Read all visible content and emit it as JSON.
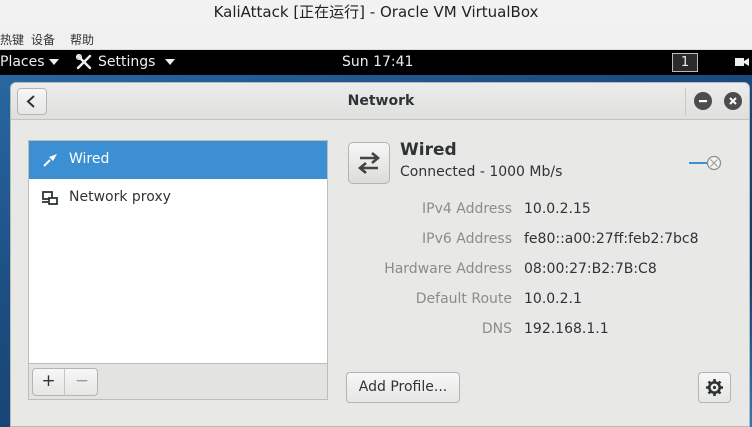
{
  "host": {
    "window_title": "KaliAttack [正在运行] - Oracle VM VirtualBox",
    "menu": [
      "热键",
      "设备",
      "帮助"
    ]
  },
  "topbar": {
    "places_label": "Places",
    "settings_label": "Settings",
    "clock": "Sun 17:41",
    "workspace": "1"
  },
  "window": {
    "title": "Network"
  },
  "sidebar": {
    "items": [
      {
        "label": "Wired",
        "icon": "ethernet-icon",
        "selected": true
      },
      {
        "label": "Network proxy",
        "icon": "proxy-icon",
        "selected": false
      }
    ],
    "add_label": "+",
    "remove_label": "−"
  },
  "device": {
    "name": "Wired",
    "status": "Connected - 1000 Mb/s",
    "toggle_on": true,
    "details": [
      {
        "label": "IPv4 Address",
        "value": "10.0.2.15"
      },
      {
        "label": "IPv6 Address",
        "value": "fe80::a00:27ff:feb2:7bc8"
      },
      {
        "label": "Hardware Address",
        "value": "08:00:27:B2:7B:C8"
      },
      {
        "label": "Default Route",
        "value": "10.0.2.1"
      },
      {
        "label": "DNS",
        "value": "192.168.1.1"
      }
    ],
    "add_profile_label": "Add Profile..."
  },
  "colors": {
    "selection": "#3c8fd2",
    "topbar": "#000000",
    "window_bg": "#e8e8e7"
  }
}
